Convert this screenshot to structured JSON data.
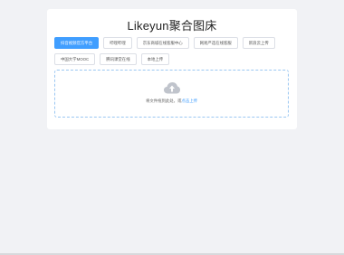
{
  "app": {
    "title": "Likeyun聚合图床"
  },
  "tabs": {
    "row1": [
      {
        "label": "抖音视频官方平台",
        "active": true
      },
      {
        "label": "哔哩哔哩",
        "active": false
      },
      {
        "label": "京东商城在线客服中心",
        "active": false
      },
      {
        "label": "网易严选在线客服",
        "active": false
      },
      {
        "label": "新浪云上传",
        "active": false
      }
    ],
    "row2": [
      {
        "label": "中国大学MOOC",
        "active": false
      },
      {
        "label": "腾讯课堂在线",
        "active": false
      },
      {
        "label": "本地上传",
        "active": false
      }
    ]
  },
  "upload": {
    "hint_text": "将文件拖到此处，或",
    "hint_link": "点击上传",
    "icon": "cloud-upload-icon"
  },
  "colors": {
    "accent": "#409eff",
    "dropzone_border": "#9bc7f2",
    "page_bg": "#f1f2f5"
  }
}
